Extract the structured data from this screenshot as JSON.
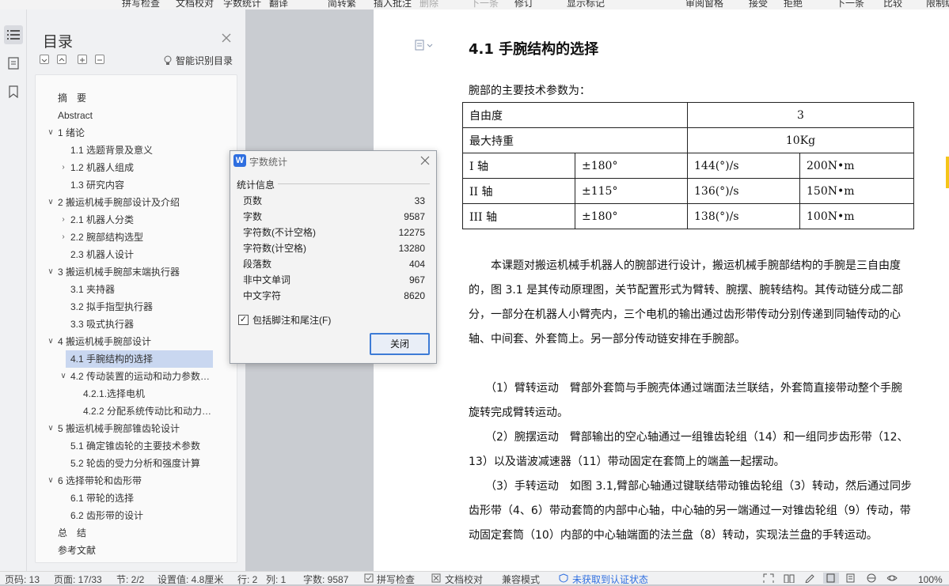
{
  "ribbon": {
    "items": [
      "拼写检查",
      "文档校对",
      "字数统计",
      "翻译",
      "简转繁",
      "插入批注",
      "删除",
      "下一条",
      "修订",
      "显示标记",
      "审阅窗格",
      "接受",
      "拒绝",
      "下一条",
      "比较",
      "限制编"
    ]
  },
  "toc": {
    "title": "目录",
    "smart_label": "智能识别目录",
    "items": [
      {
        "label": "摘　要",
        "level": 1,
        "chevron": ""
      },
      {
        "label": "Abstract",
        "level": 1,
        "chevron": ""
      },
      {
        "label": "1 绪论",
        "level": 1,
        "chevron": "down"
      },
      {
        "label": "1.1 选题背景及意义",
        "level": 2,
        "chevron": ""
      },
      {
        "label": "1.2 机器人组成",
        "level": 2,
        "chevron": "right"
      },
      {
        "label": "1.3 研究内容",
        "level": 2,
        "chevron": ""
      },
      {
        "label": "2 搬运机械手腕部设计及介绍",
        "level": 1,
        "chevron": "down"
      },
      {
        "label": "2.1 机器人分类",
        "level": 2,
        "chevron": "right"
      },
      {
        "label": "2.2 腕部结构选型",
        "level": 2,
        "chevron": "right"
      },
      {
        "label": "2.3 机器人设计",
        "level": 2,
        "chevron": ""
      },
      {
        "label": "3 搬运机械手腕部末端执行器",
        "level": 1,
        "chevron": "down"
      },
      {
        "label": "3.1 夹持器",
        "level": 2,
        "chevron": ""
      },
      {
        "label": "3.2 拟手指型执行器",
        "level": 2,
        "chevron": ""
      },
      {
        "label": "3.3 吸式执行器",
        "level": 2,
        "chevron": ""
      },
      {
        "label": "4 搬运机械手腕部设计",
        "level": 1,
        "chevron": "down"
      },
      {
        "label": "4.1 手腕结构的选择",
        "level": 2,
        "chevron": "",
        "selected": true
      },
      {
        "label": "4.2 传动装置的运动和动力参数计 ...",
        "level": 2,
        "chevron": "down"
      },
      {
        "label": "4.2.1.选择电机",
        "level": 3,
        "chevron": ""
      },
      {
        "label": "4.2.2 分配系统传动比和动力参 ...",
        "level": 3,
        "chevron": ""
      },
      {
        "label": "5 搬运机械手腕部锥齿轮设计",
        "level": 1,
        "chevron": "down"
      },
      {
        "label": "5.1 确定锥齿轮的主要技术参数",
        "level": 2,
        "chevron": ""
      },
      {
        "label": "5.2 轮齿的受力分析和强度计算",
        "level": 2,
        "chevron": ""
      },
      {
        "label": "6 选择带轮和齿形带",
        "level": 1,
        "chevron": "down"
      },
      {
        "label": "6.1 带轮的选择",
        "level": 2,
        "chevron": ""
      },
      {
        "label": "6.2 齿形带的设计",
        "level": 2,
        "chevron": ""
      },
      {
        "label": "总　结",
        "level": 1,
        "chevron": ""
      },
      {
        "label": "参考文献",
        "level": 1,
        "chevron": ""
      }
    ]
  },
  "document": {
    "heading": "4.1 手腕结构的选择",
    "params_title": "腕部的主要技术参数为：",
    "table": {
      "row1": {
        "label": "自由度",
        "value": "3"
      },
      "row2": {
        "label": "最大持重",
        "value": "10Kg"
      },
      "axes": [
        {
          "axis": "I 轴",
          "range": "±180°",
          "speed": "144(°)/s",
          "torque": "200N•m"
        },
        {
          "axis": "II 轴",
          "range": "±115°",
          "speed": "136(°)/s",
          "torque": "150N•m"
        },
        {
          "axis": "III 轴",
          "range": "±180°",
          "speed": "138(°)/s",
          "torque": "100N•m"
        }
      ]
    },
    "paragraphs": [
      "　　本课题对搬运机械手机器人的腕部进行设计，搬运机械手腕部结构的手腕是三自由度的，图 3.1 是其传动原理图，关节配置形式为臂转、腕摆、腕转结构。其传动链分成二部分，一部分在机器人小臂壳内，三个电机的输出通过齿形带传动分别传递到同轴传动的心轴、中间套、外套筒上。另一部分传动链安排在手腕部。",
      "　　（1）臂转运动　臂部外套筒与手腕壳体通过端面法兰联结，外套筒直接带动整个手腕旋转完成臂转运动。",
      "　　（2）腕摆运动　臂部输出的空心轴通过一组锥齿轮组（14）和一组同步齿形带（12、13）以及谐波减速器（11）带动固定在套筒上的端盖一起摆动。",
      "　　（3）手转运动　如图 3.1,臂部心轴通过键联结带动锥齿轮组（3）转动，然后通过同步齿形带（4、6）带动套筒的内部中心轴，中心轴的另一端通过一对锥齿轮组（9）传动，带动固定套筒（10）内部的中心轴端面的法兰盘（8）转动，实现法兰盘的手转运动。"
    ]
  },
  "dialog": {
    "title": "字数统计",
    "section": "统计信息",
    "stats": [
      {
        "label": "页数",
        "value": "33"
      },
      {
        "label": "字数",
        "value": "9587"
      },
      {
        "label": "字符数(不计空格)",
        "value": "12275"
      },
      {
        "label": "字符数(计空格)",
        "value": "13280"
      },
      {
        "label": "段落数",
        "value": "404"
      },
      {
        "label": "非中文单词",
        "value": "967"
      },
      {
        "label": "中文字符",
        "value": "8620"
      }
    ],
    "checkbox_label": "包括脚注和尾注(F)",
    "checkbox_checked": true,
    "close_button": "关闭"
  },
  "status": {
    "page_code": "页码: 13",
    "page": "页面: 17/33",
    "section": "节: 2/2",
    "setting": "设置值: 4.8厘米",
    "row": "行: 2",
    "col": "列: 1",
    "words": "字数: 9587",
    "spell": "拼写检查",
    "proof": "文档校对",
    "compat": "兼容模式",
    "cert": "未获取到认证状态",
    "zoom": "100%"
  },
  "colors": {
    "accent": "#3d7bd6",
    "selected_bg": "#c9d7f0",
    "highlight": "#f5c518"
  }
}
